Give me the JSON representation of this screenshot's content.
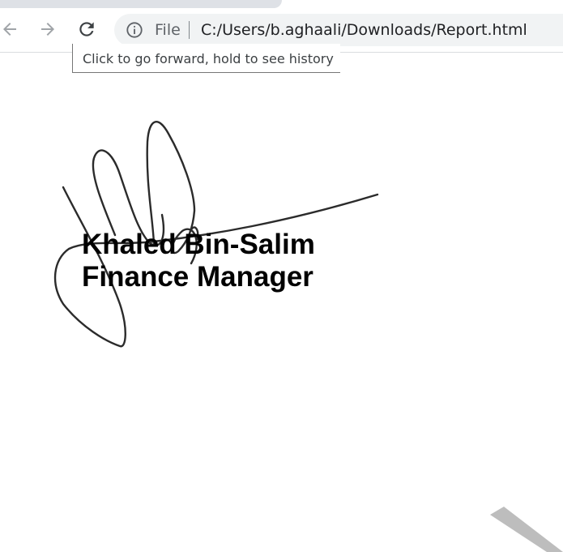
{
  "browser": {
    "omnibox": {
      "scheme_label": "File",
      "url": "C:/Users/b.aghaali/Downloads/Report.html"
    },
    "buttons": {
      "back_icon": "arrow-left",
      "forward_icon": "arrow-right",
      "reload_icon": "reload"
    },
    "tooltip": "Click to go forward, hold to see history"
  },
  "document": {
    "signer_name": "Khaled Bin-Salim",
    "signer_title": "Finance Manager",
    "signature_image": "handwritten-signature"
  },
  "colors": {
    "toolbar_bg": "#ffffff",
    "omnibox_bg": "#f1f3f4",
    "tab_strip": "#dee1e6",
    "icon_disabled": "#a0a4a8",
    "icon_enabled": "#5f6368",
    "stripe": "#bdbdbd"
  }
}
